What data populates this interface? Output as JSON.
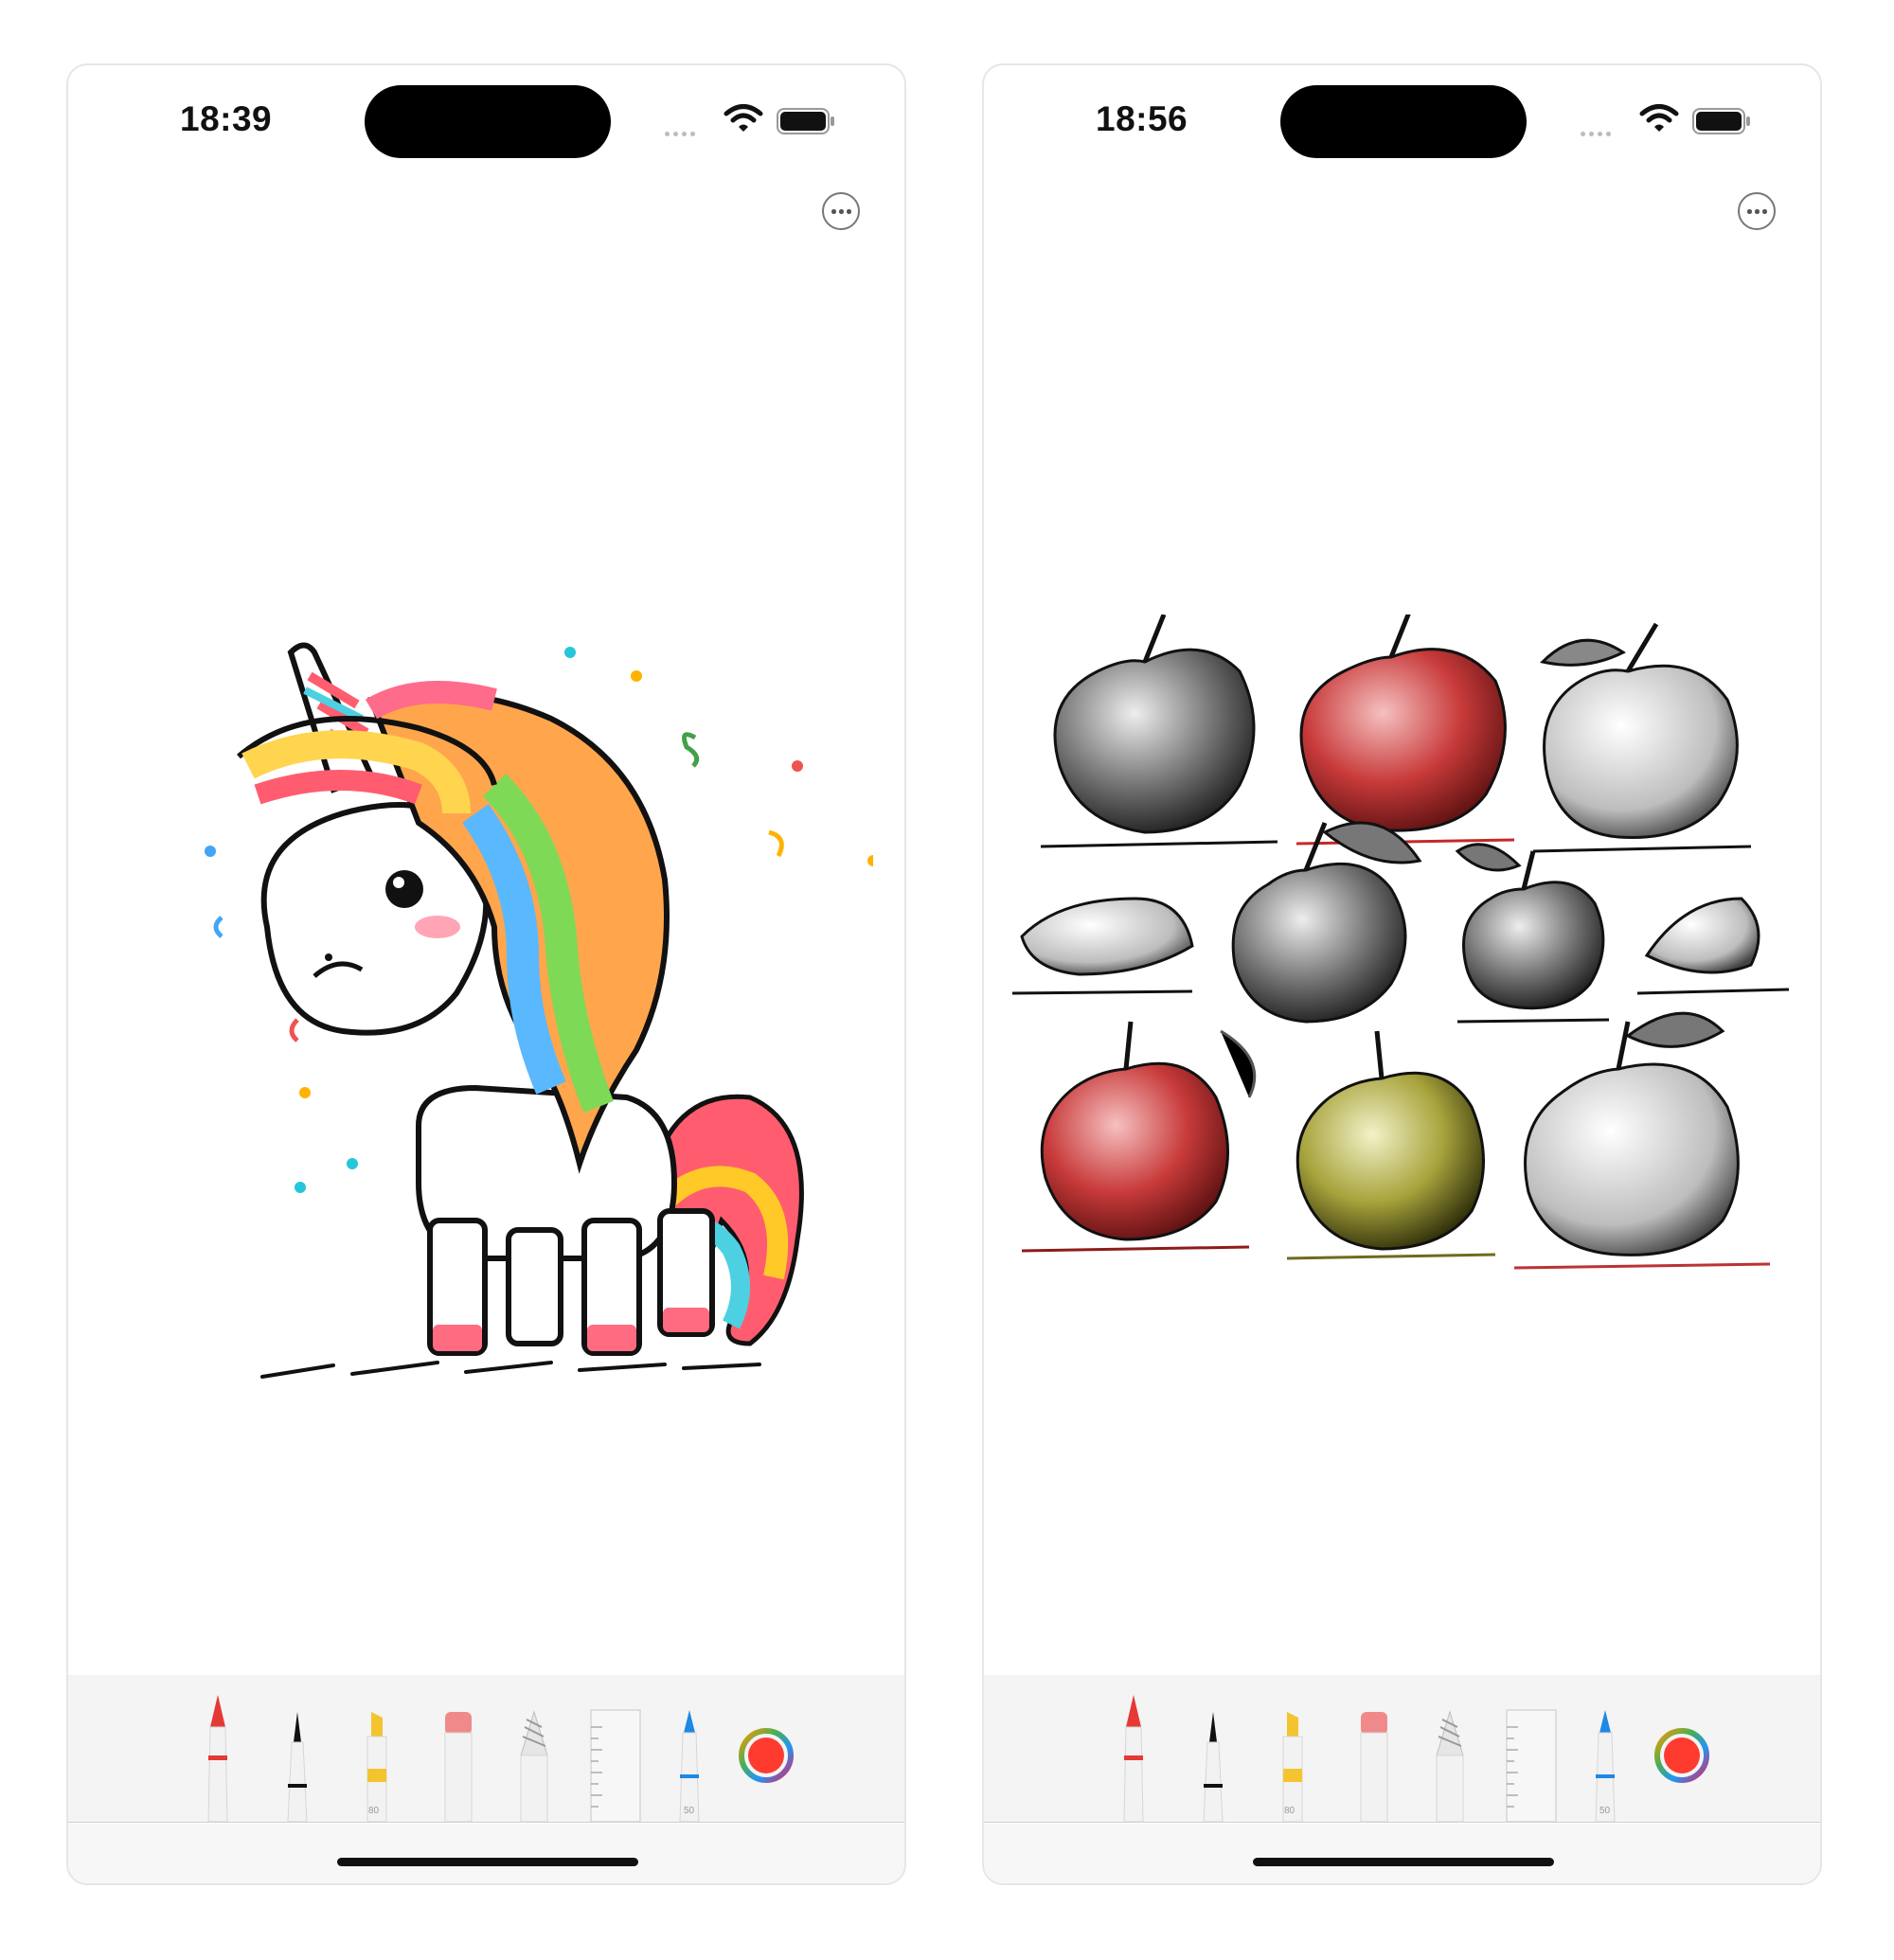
{
  "screens": [
    {
      "status_bar": {
        "time": "18:39"
      },
      "more_button_icon": "ellipsis-circle-icon",
      "artwork": {
        "subject": "unicorn",
        "icon": "unicorn-drawing"
      },
      "toolbar": {
        "tools": [
          {
            "name": "pen",
            "icon": "pen-icon",
            "color": "#e53935"
          },
          {
            "name": "fineliner",
            "icon": "fineliner-icon",
            "color": "#111111"
          },
          {
            "name": "highlighter",
            "icon": "highlighter-icon",
            "color": "#f4c430",
            "label": "80"
          },
          {
            "name": "eraser",
            "icon": "eraser-icon",
            "color": "#f08a8a"
          },
          {
            "name": "lasso",
            "icon": "lasso-icon"
          },
          {
            "name": "ruler",
            "icon": "ruler-icon"
          },
          {
            "name": "pencil",
            "icon": "pencil-icon",
            "color": "#1e88e5",
            "label": "50"
          }
        ],
        "color_picker": {
          "icon": "color-picker-icon",
          "selected_color": "#ff3b30"
        }
      }
    },
    {
      "status_bar": {
        "time": "18:56"
      },
      "more_button_icon": "ellipsis-circle-icon",
      "artwork": {
        "subject": "apples",
        "icon": "apples-drawing"
      },
      "toolbar": {
        "tools": [
          {
            "name": "pen",
            "icon": "pen-icon",
            "color": "#e53935"
          },
          {
            "name": "fineliner",
            "icon": "fineliner-icon",
            "color": "#111111"
          },
          {
            "name": "highlighter",
            "icon": "highlighter-icon",
            "color": "#f4c430",
            "label": "80"
          },
          {
            "name": "eraser",
            "icon": "eraser-icon",
            "color": "#f08a8a"
          },
          {
            "name": "lasso",
            "icon": "lasso-icon"
          },
          {
            "name": "ruler",
            "icon": "ruler-icon"
          },
          {
            "name": "pencil",
            "icon": "pencil-icon",
            "color": "#1e88e5",
            "label": "50"
          }
        ],
        "color_picker": {
          "icon": "color-picker-icon",
          "selected_color": "#ff3b30"
        }
      }
    }
  ]
}
